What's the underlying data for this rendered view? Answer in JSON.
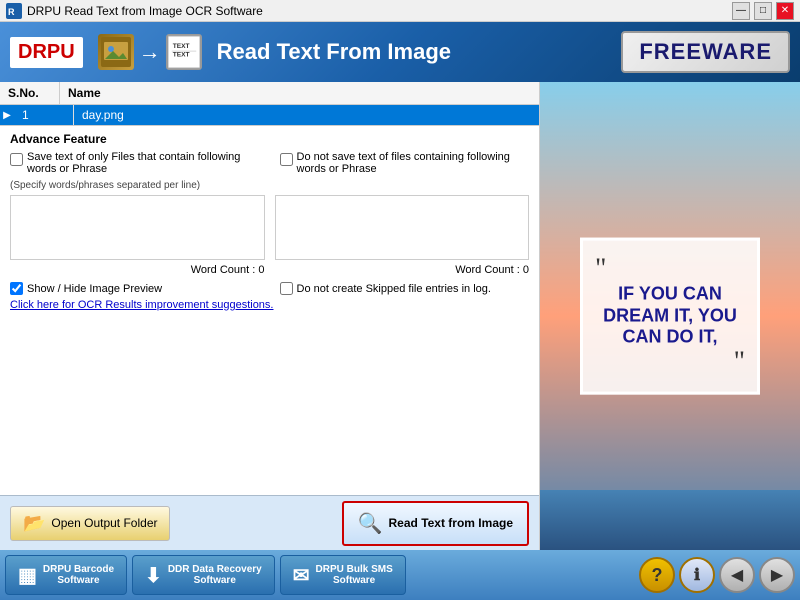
{
  "titlebar": {
    "title": "DRPU Read Text from Image OCR Software"
  },
  "header": {
    "logo": "DRPU",
    "title": "Read Text From Image",
    "freeware": "FREEWARE"
  },
  "table": {
    "columns": [
      "S.No.",
      "Name"
    ],
    "rows": [
      {
        "sno": "1",
        "name": "day.png"
      }
    ]
  },
  "advance": {
    "title": "Advance Feature",
    "check1_label": "Save text of only Files that contain following words or Phrase",
    "check2_label": "Do not save text of files containing following words or Phrase",
    "phrase_hint": "(Specify words/phrases separated per line)",
    "word_count_label1": "Word Count : 0",
    "word_count_label2": "Word Count : 0",
    "show_preview_label": "Show / Hide Image Preview",
    "no_skip_label": "Do not create Skipped file entries in log.",
    "ocr_link": "Click here for OCR Results improvement suggestions."
  },
  "buttons": {
    "open_folder": "Open Output Folder",
    "read_image": "Read Text from Image"
  },
  "preview": {
    "quote": "IF YOU CAN DREAM IT, YOU CAN DO IT,"
  },
  "taskbar": {
    "items": [
      {
        "id": "barcode",
        "label": "DRPU Barcode\nSoftware",
        "icon": "▦"
      },
      {
        "id": "ddr",
        "label": "DDR Data Recovery\nSoftware",
        "icon": "⬇"
      },
      {
        "id": "sms",
        "label": "DRPU Bulk SMS\nSoftware",
        "icon": "✉"
      }
    ],
    "right_buttons": [
      "?",
      "ℹ",
      "◀",
      "▶"
    ]
  }
}
